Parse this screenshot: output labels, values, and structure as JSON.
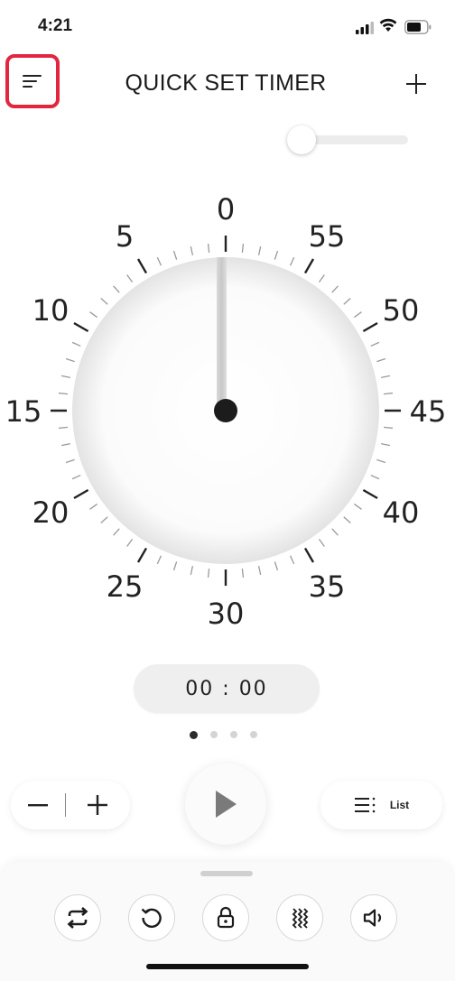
{
  "status_bar": {
    "time": "4:21"
  },
  "header": {
    "title": "QUICK SET TIMER",
    "menu_icon": "menu-icon",
    "add_icon": "plus-icon",
    "highlight_color": "#e3263f"
  },
  "volume_slider": {
    "value_fraction": 0.05
  },
  "dial": {
    "labels": [
      "0",
      "5",
      "10",
      "15",
      "20",
      "25",
      "30",
      "35",
      "40",
      "45",
      "50",
      "55"
    ],
    "set_minutes": 0
  },
  "time_display": {
    "value": "00 : 00"
  },
  "pager": {
    "pages": 4,
    "active_index": 0
  },
  "controls": {
    "minus_icon": "minus-icon",
    "plus_icon": "plus-icon",
    "play_icon": "play-icon",
    "list_label": "List",
    "list_icon": "list-icon"
  },
  "toolbar": {
    "buttons": [
      "repeat-icon",
      "reset-icon",
      "lock-icon",
      "vibrate-icon",
      "sound-icon"
    ]
  }
}
